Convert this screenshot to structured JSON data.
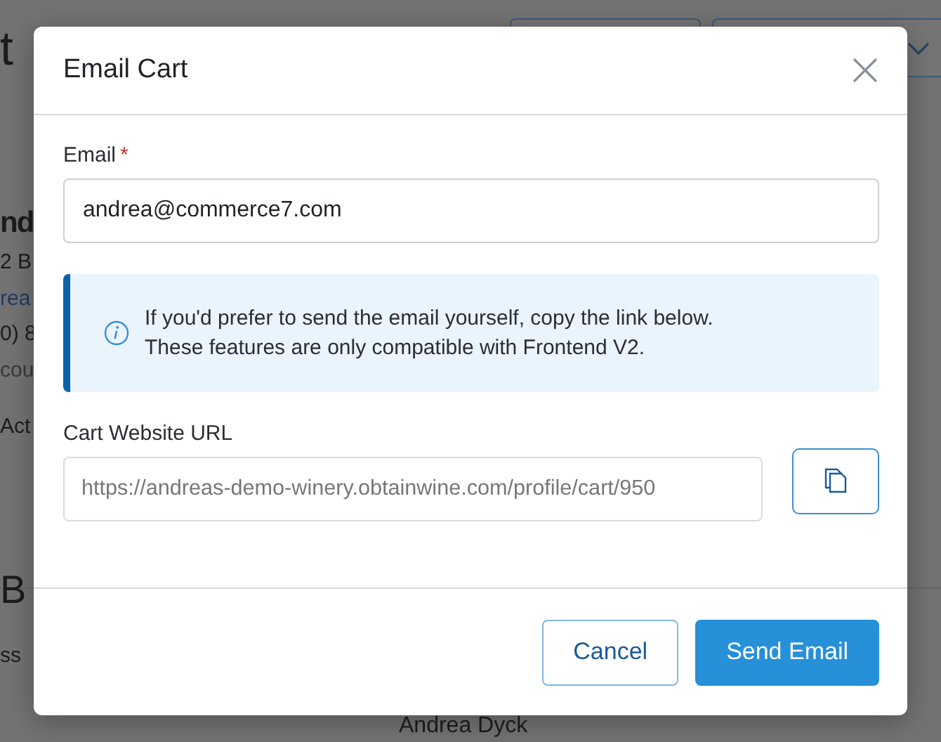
{
  "background_page": {
    "heading": "t",
    "customer": {
      "name": "nd",
      "address": "2 B",
      "email": "rea",
      "phone": "0) 8",
      "note": "cou",
      "actions": "Act"
    },
    "section_heading": "B",
    "section_label": "ss",
    "contact_name": "Andrea Dyck"
  },
  "dialog": {
    "title": "Email Cart",
    "email_field": {
      "label": "Email",
      "required_marker": "*",
      "value": "andrea@commerce7.com"
    },
    "notice": {
      "lines": [
        "If you'd prefer to send the email yourself, copy the link below.",
        "These features are only compatible with Frontend V2."
      ]
    },
    "url_field": {
      "label": "Cart Website URL",
      "value": "https://andreas-demo-winery.obtainwine.com/profile/cart/950"
    },
    "buttons": [
      {
        "label": "Cancel",
        "kind": "secondary"
      },
      {
        "label": "Send Email",
        "kind": "primary"
      }
    ]
  }
}
